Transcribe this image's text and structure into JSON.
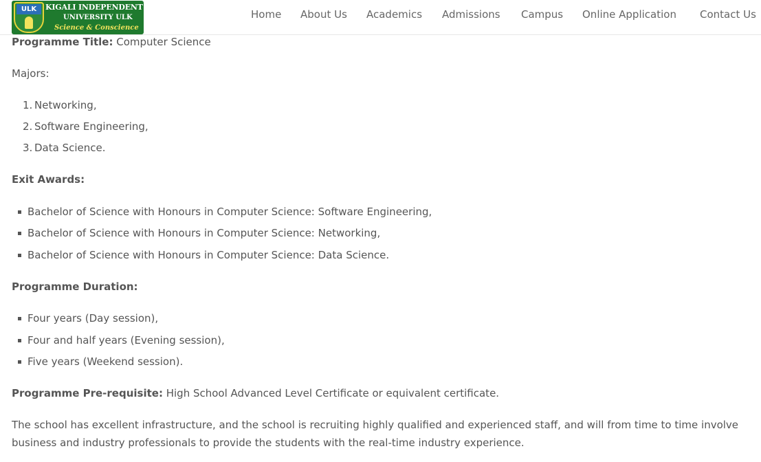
{
  "header": {
    "logo": {
      "badge": "ULK",
      "line1": "KIGALI INDEPENDENT",
      "line2": "UNIVERSITY ULK",
      "line3": "Science & Conscience"
    },
    "nav": [
      "Home",
      "About Us",
      "Academics",
      "Admissions",
      "Campus",
      "Online Application",
      "Contact Us"
    ]
  },
  "content": {
    "programme_title_label": "Programme Title:",
    "programme_title_value": "Computer Science",
    "majors_label": "Majors:",
    "majors": [
      "Networking,",
      "Software Engineering,",
      "Data Science."
    ],
    "exit_awards_label": "Exit Awards:",
    "exit_awards": [
      "Bachelor of Science with Honours in Computer Science: Software Engineering,",
      "Bachelor of Science with Honours in Computer Science: Networking,",
      "Bachelor of Science with Honours in Computer Science: Data Science."
    ],
    "duration_label": "Programme Duration:",
    "durations": [
      "Four years (Day session),",
      "Four and half years (Evening session),",
      "Five years (Weekend session)."
    ],
    "prerequisite_label": "Programme Pre-requisite:",
    "prerequisite_value": "High School Advanced Level Certificate or equivalent certificate.",
    "closing_paragraph": "The school has excellent infrastructure, and the school is recruiting highly qualified and experienced staff, and will from time to time involve business and industry professionals to provide the students with the real-time industry experience."
  }
}
